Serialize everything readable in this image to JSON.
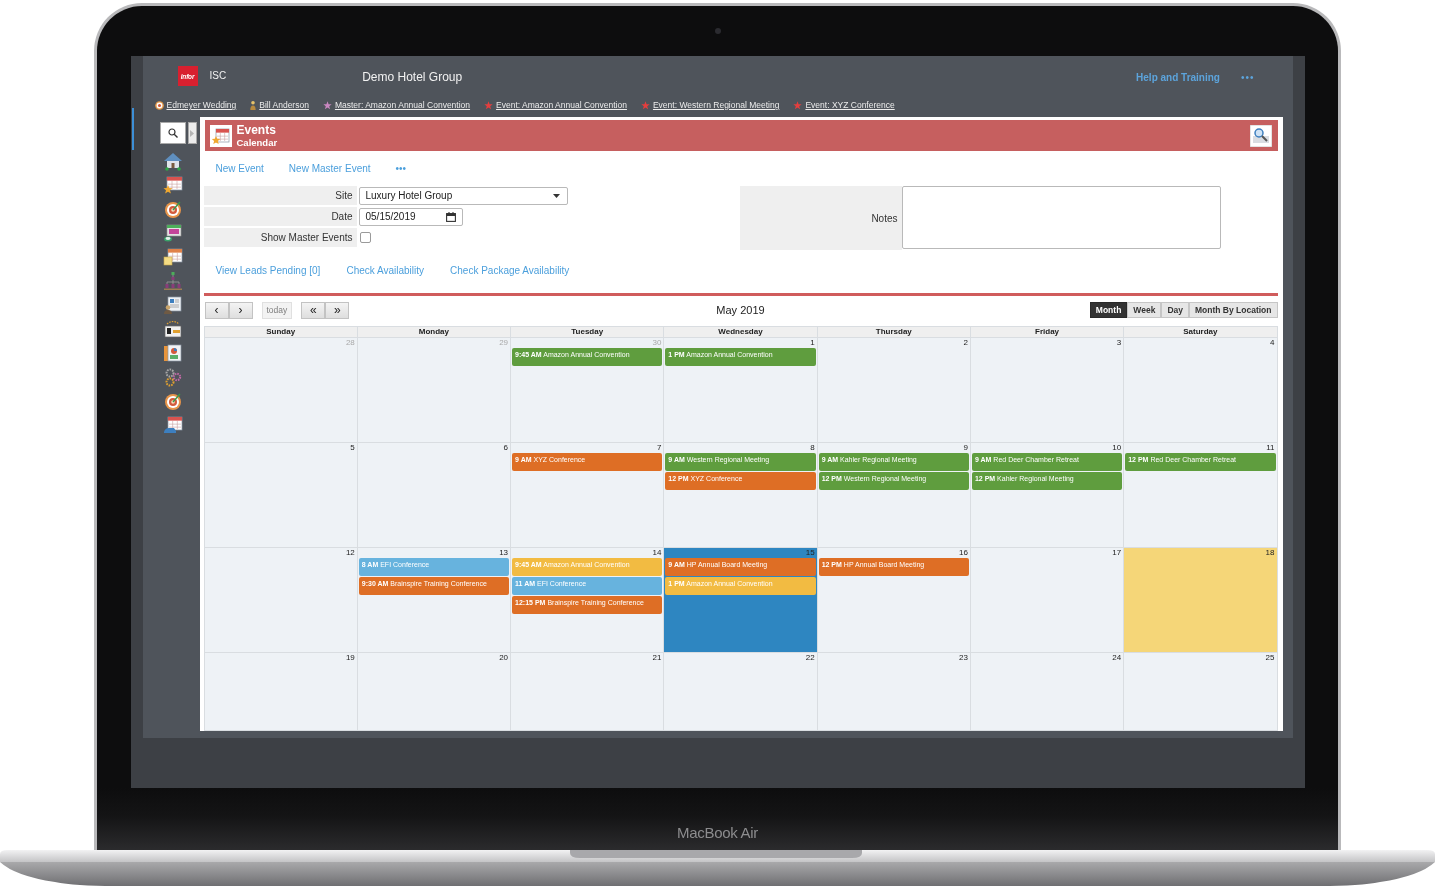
{
  "device": {
    "label": "MacBook Air"
  },
  "app": {
    "logo": "infor",
    "product": "ISC",
    "title": "Demo Hotel Group",
    "help": "Help and Training",
    "more": "•••"
  },
  "recent_items": [
    {
      "kind": "target",
      "label": "Edmeyer Wedding"
    },
    {
      "kind": "person",
      "label": "Bill Anderson"
    },
    {
      "kind": "master",
      "label": "Master: Amazon Annual Convention"
    },
    {
      "kind": "event",
      "label": "Event: Amazon Annual Convention"
    },
    {
      "kind": "event",
      "label": "Event: Western Regional Meeting"
    },
    {
      "kind": "event",
      "label": "Event: XYZ Conference"
    }
  ],
  "panel": {
    "title": "Events",
    "subtitle": "Calendar"
  },
  "actions": [
    "New Event",
    "New Master Event",
    "•••"
  ],
  "form": {
    "fields": [
      {
        "kind": "select",
        "label": "Site",
        "value": "Luxury Hotel Group"
      },
      {
        "kind": "date",
        "label": "Date",
        "value": "05/15/2019"
      },
      {
        "kind": "checkbox",
        "label": "Show Master Events",
        "checked": false
      }
    ],
    "notes": {
      "label": "Notes"
    }
  },
  "links": [
    "View Leads Pending [0]",
    "Check Availability",
    "Check Package Availability"
  ],
  "calendar": {
    "nav": [
      {
        "buttons": [
          {
            "label": "‹",
            "disabled": false
          },
          {
            "label": "›",
            "disabled": false
          }
        ]
      },
      {
        "buttons": [
          {
            "label": "today",
            "disabled": true
          }
        ]
      },
      {
        "buttons": [
          {
            "label": "«",
            "disabled": false
          },
          {
            "label": "»",
            "disabled": false
          }
        ]
      }
    ],
    "title": "May 2019",
    "views": [
      {
        "label": "Month",
        "selected": true
      },
      {
        "label": "Week",
        "selected": false
      },
      {
        "label": "Day",
        "selected": false
      },
      {
        "label": "Month By Location",
        "selected": false
      }
    ],
    "weekdays": [
      "Sunday",
      "Monday",
      "Tuesday",
      "Wednesday",
      "Thursday",
      "Friday",
      "Saturday"
    ],
    "weeks": [
      {
        "days": [
          {
            "number": "28",
            "other_month": true,
            "selected": false,
            "today": false
          },
          {
            "number": "29",
            "other_month": true,
            "selected": false,
            "today": false
          },
          {
            "number": "30",
            "other_month": true,
            "selected": false,
            "today": false,
            "events": [
              {
                "time": "9:45 AM",
                "title": "Amazon Annual Convention",
                "color": "#5f9d3e"
              }
            ]
          },
          {
            "number": "1",
            "other_month": false,
            "selected": false,
            "today": false,
            "events": [
              {
                "time": "1 PM",
                "title": "Amazon Annual Convention",
                "color": "#5f9d3e"
              }
            ]
          },
          {
            "number": "2",
            "other_month": false,
            "selected": false,
            "today": false
          },
          {
            "number": "3",
            "other_month": false,
            "selected": false,
            "today": false
          },
          {
            "number": "4",
            "other_month": false,
            "selected": false,
            "today": false
          }
        ]
      },
      {
        "days": [
          {
            "number": "5",
            "other_month": false,
            "selected": false,
            "today": false
          },
          {
            "number": "6",
            "other_month": false,
            "selected": false,
            "today": false
          },
          {
            "number": "7",
            "other_month": false,
            "selected": false,
            "today": false,
            "events": [
              {
                "time": "9 AM",
                "title": "XYZ Conference",
                "color": "#de6e25"
              }
            ]
          },
          {
            "number": "8",
            "other_month": false,
            "selected": false,
            "today": false,
            "events": [
              {
                "time": "9 AM",
                "title": "Western Regional Meeting",
                "color": "#5f9d3e"
              },
              {
                "time": "12 PM",
                "title": "XYZ Conference",
                "color": "#de6e25"
              }
            ]
          },
          {
            "number": "9",
            "other_month": false,
            "selected": false,
            "today": false,
            "events": [
              {
                "time": "9 AM",
                "title": "Kahler Regional Meeting",
                "color": "#5f9d3e"
              },
              {
                "time": "12 PM",
                "title": "Western Regional Meeting",
                "color": "#5f9d3e"
              }
            ]
          },
          {
            "number": "10",
            "other_month": false,
            "selected": false,
            "today": false,
            "events": [
              {
                "time": "9 AM",
                "title": "Red Deer Chamber Retreat",
                "color": "#5f9d3e"
              },
              {
                "time": "12 PM",
                "title": "Kahler Regional Meeting",
                "color": "#5f9d3e"
              }
            ]
          },
          {
            "number": "11",
            "other_month": false,
            "selected": false,
            "today": false,
            "events": [
              {
                "time": "12 PM",
                "title": "Red Deer Chamber Retreat",
                "color": "#5f9d3e"
              }
            ]
          }
        ]
      },
      {
        "days": [
          {
            "number": "12",
            "other_month": false,
            "selected": false,
            "today": false
          },
          {
            "number": "13",
            "other_month": false,
            "selected": false,
            "today": false,
            "events": [
              {
                "time": "8 AM",
                "title": "EFI Conference",
                "color": "#67b3de"
              },
              {
                "time": "9:30 AM",
                "title": "Brainspire Training Conference",
                "color": "#de6e25"
              }
            ]
          },
          {
            "number": "14",
            "other_month": false,
            "selected": false,
            "today": false,
            "events": [
              {
                "time": "9:45 AM",
                "title": "Amazon Annual Convention",
                "color": "#f2bb42"
              },
              {
                "time": "11 AM",
                "title": "EFI Conference",
                "color": "#67b3de"
              },
              {
                "time": "12:15 PM",
                "title": "Brainspire Training Conference",
                "color": "#de6e25"
              }
            ]
          },
          {
            "number": "15",
            "other_month": false,
            "selected": true,
            "today": false,
            "events": [
              {
                "time": "9 AM",
                "title": "HP Annual Board Meeting",
                "color": "#de6e25"
              },
              {
                "time": "1 PM",
                "title": "Amazon Annual Convention",
                "color": "#f2bb42"
              }
            ]
          },
          {
            "number": "16",
            "other_month": false,
            "selected": false,
            "today": false,
            "events": [
              {
                "time": "12 PM",
                "title": "HP Annual Board Meeting",
                "color": "#de6e25"
              }
            ]
          },
          {
            "number": "17",
            "other_month": false,
            "selected": false,
            "today": false
          },
          {
            "number": "18",
            "other_month": false,
            "selected": false,
            "today": true
          }
        ]
      },
      {
        "days": [
          {
            "number": "19",
            "other_month": false,
            "selected": false,
            "today": false
          },
          {
            "number": "20",
            "other_month": false,
            "selected": false,
            "today": false
          },
          {
            "number": "21",
            "other_month": false,
            "selected": false,
            "today": false
          },
          {
            "number": "22",
            "other_month": false,
            "selected": false,
            "today": false
          },
          {
            "number": "23",
            "other_month": false,
            "selected": false,
            "today": false
          },
          {
            "number": "24",
            "other_month": false,
            "selected": false,
            "today": false
          },
          {
            "number": "25",
            "other_month": false,
            "selected": false,
            "today": false
          }
        ]
      }
    ]
  }
}
